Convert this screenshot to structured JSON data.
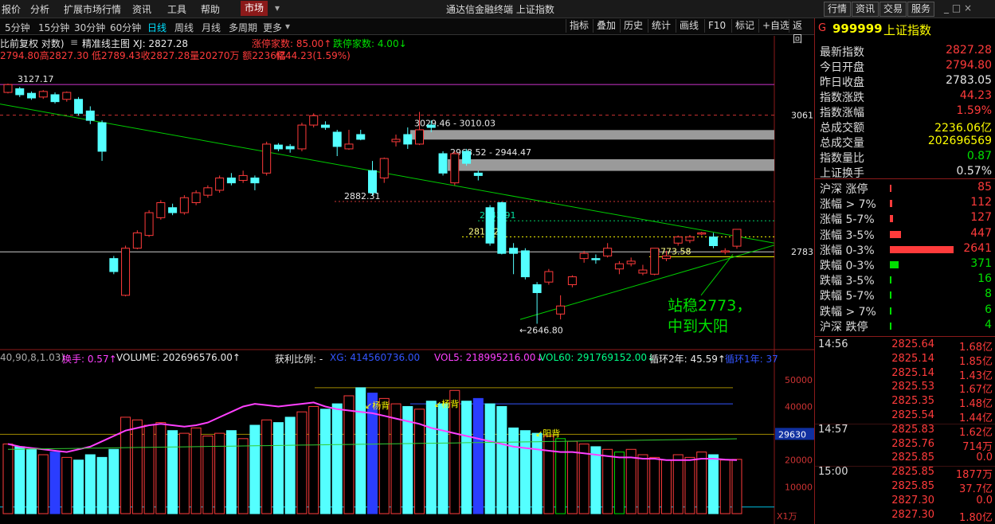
{
  "window": {
    "title": "通达信金融终端 上证指数",
    "menu": [
      "报价",
      "分析",
      "扩展市场行情",
      "资讯",
      "工具",
      "帮助"
    ],
    "market_tab": "市场",
    "right_tabs": [
      "行情",
      "资讯",
      "交易",
      "服务"
    ],
    "controls": "_ □ ×"
  },
  "toolbar": {
    "periods": [
      "5分钟",
      "15分钟",
      "30分钟",
      "60分钟",
      "日线",
      "周线",
      "月线",
      "多周期",
      "更多"
    ],
    "active_period": "日线",
    "tools": [
      "指标",
      "叠加",
      "历史",
      "统计",
      "画线",
      "F10",
      "标记",
      "+自选",
      "返回"
    ]
  },
  "info": {
    "line1_left": "比前复权 对数)",
    "line1_icon": "≡",
    "line1_main": "精准线主图 XJ: 2827.28",
    "limit_up": "涨停家数: 85.00↑",
    "limit_down": "跌停家数: 4.00↓",
    "line2": "2794.80高2827.30 低2789.43收2827.28量20270万 额2236亿",
    "line2_change": "幅44.23(1.59%)"
  },
  "chart_data": {
    "type": "candlestick",
    "y_scale": "log",
    "ylim": [
      2620,
      3150
    ],
    "y_ticks": [
      "3061",
      "2783"
    ],
    "candles": [
      {
        "o": 3110,
        "c": 3127,
        "h": 3129,
        "l": 3108
      },
      {
        "o": 3118,
        "c": 3105,
        "h": 3122,
        "l": 3100
      },
      {
        "o": 3108,
        "c": 3098,
        "h": 3112,
        "l": 3094
      },
      {
        "o": 3100,
        "c": 3112,
        "h": 3115,
        "l": 3096
      },
      {
        "o": 3105,
        "c": 3090,
        "h": 3110,
        "l": 3086
      },
      {
        "o": 3095,
        "c": 3110,
        "h": 3112,
        "l": 3090
      },
      {
        "o": 3095,
        "c": 3065,
        "h": 3100,
        "l": 3060
      },
      {
        "o": 3070,
        "c": 3050,
        "h": 3080,
        "l": 3042
      },
      {
        "o": 3045,
        "c": 2985,
        "h": 3050,
        "l": 2965
      },
      {
        "o": 2770,
        "c": 2745,
        "h": 2775,
        "l": 2740
      },
      {
        "o": 2700,
        "c": 2790,
        "h": 2795,
        "l": 2698
      },
      {
        "o": 2790,
        "c": 2820,
        "h": 2825,
        "l": 2788
      },
      {
        "o": 2815,
        "c": 2860,
        "h": 2865,
        "l": 2812
      },
      {
        "o": 2850,
        "c": 2880,
        "h": 2885,
        "l": 2846
      },
      {
        "o": 2870,
        "c": 2860,
        "h": 2878,
        "l": 2855
      },
      {
        "o": 2860,
        "c": 2890,
        "h": 2895,
        "l": 2856
      },
      {
        "o": 2880,
        "c": 2900,
        "h": 2905,
        "l": 2875
      },
      {
        "o": 2895,
        "c": 2910,
        "h": 2915,
        "l": 2890
      },
      {
        "o": 2905,
        "c": 2930,
        "h": 2935,
        "l": 2900
      },
      {
        "o": 2930,
        "c": 2920,
        "h": 2940,
        "l": 2915
      },
      {
        "o": 2925,
        "c": 2935,
        "h": 2945,
        "l": 2920
      },
      {
        "o": 2930,
        "c": 2920,
        "h": 2935,
        "l": 2905
      },
      {
        "o": 2940,
        "c": 3000,
        "h": 3005,
        "l": 2935
      },
      {
        "o": 2998,
        "c": 2990,
        "h": 3002,
        "l": 2985
      },
      {
        "o": 2995,
        "c": 2990,
        "h": 3000,
        "l": 2982
      },
      {
        "o": 2990,
        "c": 3040,
        "h": 3045,
        "l": 2985
      },
      {
        "o": 3040,
        "c": 3060,
        "h": 3065,
        "l": 3035
      },
      {
        "o": 3040,
        "c": 3035,
        "h": 3048,
        "l": 3030
      },
      {
        "o": 3025,
        "c": 2995,
        "h": 3030,
        "l": 2975
      },
      {
        "o": 2990,
        "c": 3000,
        "h": 3030,
        "l": 2988
      },
      {
        "o": 3020,
        "c": 3010,
        "h": 3030,
        "l": 3008
      },
      {
        "o": 2945,
        "c": 2900,
        "h": 2965,
        "l": 2895
      },
      {
        "o": 2930,
        "c": 2970,
        "h": 2972,
        "l": 2920
      },
      {
        "o": 3005,
        "c": 3010,
        "h": 3020,
        "l": 2995
      },
      {
        "o": 3020,
        "c": 3000,
        "h": 3035,
        "l": 2990
      },
      {
        "o": 3000,
        "c": 3030,
        "h": 3068,
        "l": 2998
      },
      {
        "o": 3040,
        "c": 3035,
        "h": 3050,
        "l": 3025
      },
      {
        "o": 2980,
        "c": 2940,
        "h": 2985,
        "l": 2935
      },
      {
        "o": 2920,
        "c": 2980,
        "h": 2985,
        "l": 2915
      },
      {
        "o": 2985,
        "c": 2960,
        "h": 2990,
        "l": 2955
      },
      {
        "o": 2940,
        "c": 2935,
        "h": 2945,
        "l": 2925
      },
      {
        "o": 2870,
        "c": 2800,
        "h": 2875,
        "l": 2795
      },
      {
        "o": 2880,
        "c": 2780,
        "h": 2882,
        "l": 2778
      },
      {
        "o": 2790,
        "c": 2780,
        "h": 2800,
        "l": 2740
      },
      {
        "o": 2785,
        "c": 2735,
        "h": 2790,
        "l": 2730
      },
      {
        "o": 2720,
        "c": 2705,
        "h": 2725,
        "l": 2647
      },
      {
        "o": 2725,
        "c": 2745,
        "h": 2750,
        "l": 2720
      },
      {
        "o": 2665,
        "c": 2680,
        "h": 2700,
        "l": 2655
      },
      {
        "o": 2720,
        "c": 2735,
        "h": 2738,
        "l": 2715
      },
      {
        "o": 2770,
        "c": 2780,
        "h": 2785,
        "l": 2762
      },
      {
        "o": 2770,
        "c": 2768,
        "h": 2778,
        "l": 2760
      },
      {
        "o": 2775,
        "c": 2790,
        "h": 2800,
        "l": 2772
      },
      {
        "o": 2750,
        "c": 2760,
        "h": 2765,
        "l": 2740
      },
      {
        "o": 2760,
        "c": 2765,
        "h": 2772,
        "l": 2755
      },
      {
        "o": 2742,
        "c": 2748,
        "h": 2758,
        "l": 2738
      },
      {
        "o": 2740,
        "c": 2790,
        "h": 2790,
        "l": 2738
      },
      {
        "o": 2770,
        "c": 2775,
        "h": 2785,
        "l": 2765
      },
      {
        "o": 2800,
        "c": 2812,
        "h": 2815,
        "l": 2795
      },
      {
        "o": 2805,
        "c": 2812,
        "h": 2816,
        "l": 2800
      },
      {
        "o": 2818,
        "c": 2820,
        "h": 2822,
        "l": 2815
      },
      {
        "o": 2812,
        "c": 2795,
        "h": 2820,
        "l": 2790
      },
      {
        "o": 2785,
        "c": 2785,
        "h": 2790,
        "l": 2778
      },
      {
        "o": 2794,
        "c": 2827,
        "h": 2827,
        "l": 2789
      }
    ],
    "zones": [
      {
        "label": "3029.46 - 3010.03",
        "top": 3029.46,
        "bottom": 3010.03
      },
      {
        "label": "2968.52 - 2944.47",
        "top": 2968.52,
        "bottom": 2944.47
      }
    ],
    "levels": [
      {
        "value": 3127.17,
        "label": "3127.17",
        "color": "#cc33cc"
      },
      {
        "value": 3061,
        "label": "",
        "color": "#cc3333"
      },
      {
        "value": 2882.31,
        "label": "2882.31",
        "color": "#cc3333"
      },
      {
        "value": 2843.91,
        "label": "2843.91",
        "color": "#00cc66"
      },
      {
        "value": 2812.23,
        "label": "2812.23",
        "color": "#ffff00"
      },
      {
        "value": 2783,
        "label": "",
        "color": "#cccccc"
      },
      {
        "value": 2773.58,
        "label": "2773.58",
        "color": "#ffff00"
      }
    ],
    "low_label": "2646.80",
    "annotation": [
      "站稳2773，",
      "中到大阳"
    ]
  },
  "vol_info": {
    "params": "40,90,8,1.03)",
    "turnover": "换手: 0.57↑",
    "volume": "VOLUME: 202696576.00↑",
    "profit": "获利比例: -",
    "xg": "XG: 414560736.00",
    "vol5": "VOL5: 218995216.00↓",
    "vol60": "VOL60: 291769152.00↓",
    "cycle2": "循环2年: 45.59↑",
    "cycle1": "循环1年: 37",
    "labels": [
      "杨背",
      "杨背",
      "阳背"
    ],
    "y_ticks": [
      "50000",
      "40000",
      "30000",
      "20000",
      "10000"
    ],
    "current_marker": "29630",
    "unit": "X1万",
    "volumes": [
      26000,
      25000,
      24000,
      22000,
      23000,
      21000,
      20000,
      22000,
      21000,
      24000,
      36000,
      35000,
      33000,
      34000,
      31000,
      30000,
      32000,
      29000,
      30000,
      31000,
      28000,
      33000,
      35000,
      34000,
      36000,
      38000,
      40000,
      39000,
      41000,
      44000,
      47000,
      45000,
      43000,
      41000,
      40000,
      39000,
      42000,
      41000,
      46000,
      42000,
      43000,
      41000,
      40000,
      32000,
      31000,
      30000,
      29000,
      28000,
      27000,
      26000,
      25000,
      24000,
      23000,
      24000,
      22000,
      21000,
      20000,
      22000,
      21000,
      23000,
      22000,
      20000,
      20270
    ],
    "ma_line": [
      26000,
      25000,
      24500,
      24000,
      23500,
      23000,
      24000,
      25000,
      27000,
      29000,
      31000,
      32000,
      33000,
      33500,
      33000,
      32500,
      33000,
      34000,
      36000,
      38000,
      40000,
      41000,
      40500,
      40000,
      40500,
      41000,
      41500,
      40000,
      39000,
      38500,
      38000,
      37500,
      36500,
      35500,
      34500,
      33500,
      32000,
      31000,
      30000,
      29000,
      28000,
      27000,
      26000,
      25000,
      24500,
      24000,
      23500,
      23000,
      23000,
      22500,
      22000,
      21500,
      21000,
      21000,
      20500,
      20500,
      20000,
      20000,
      20000,
      20500,
      20500,
      20200,
      20000
    ]
  },
  "right_panel": {
    "code_icon": "G",
    "code": "999999",
    "name": "上证指数",
    "rows": [
      {
        "label": "最新指数",
        "value": "2827.28",
        "color": "#ff3b3b"
      },
      {
        "label": "今日开盘",
        "value": "2794.80",
        "color": "#ff3b3b"
      },
      {
        "label": "昨日收盘",
        "value": "2783.05",
        "color": "#e8e8e8"
      },
      {
        "label": "指数涨跌",
        "value": "44.23",
        "color": "#ff3b3b"
      },
      {
        "label": "指数涨幅",
        "value": "1.59%",
        "color": "#ff3b3b"
      },
      {
        "label": "总成交额",
        "value": "2236.06亿",
        "color": "#ffff00"
      },
      {
        "label": "总成交量",
        "value": "202696569",
        "color": "#ffff00"
      },
      {
        "label": "指数量比",
        "value": "0.87",
        "color": "#00e000"
      },
      {
        "label": "上证换手",
        "value": "0.57%",
        "color": "#e8e8e8"
      }
    ],
    "breadth": [
      {
        "label": "沪深 涨停",
        "value": "85",
        "color": "#ff3b3b",
        "frac": 0.03
      },
      {
        "label": "涨幅 > 7%",
        "value": "112",
        "color": "#ff3b3b",
        "frac": 0.04
      },
      {
        "label": "涨幅 5-7%",
        "value": "127",
        "color": "#ff3b3b",
        "frac": 0.05
      },
      {
        "label": "涨幅 3-5%",
        "value": "447",
        "color": "#ff3b3b",
        "frac": 0.17
      },
      {
        "label": "涨幅 0-3%",
        "value": "2641",
        "color": "#ff3b3b",
        "frac": 1.0
      },
      {
        "label": "跌幅 0-3%",
        "value": "371",
        "color": "#00e000",
        "frac": 0.14
      },
      {
        "label": "跌幅 3-5%",
        "value": "16",
        "color": "#00e000",
        "frac": 0.01
      },
      {
        "label": "跌幅 5-7%",
        "value": "8",
        "color": "#00e000",
        "frac": 0.005
      },
      {
        "label": "跌幅 > 7%",
        "value": "6",
        "color": "#00e000",
        "frac": 0.005
      },
      {
        "label": "沪深 跌停",
        "value": "4",
        "color": "#00e000",
        "frac": 0.0
      }
    ],
    "ticks": [
      {
        "time": "14:56",
        "price": "2825.64",
        "vol": "1.68亿"
      },
      {
        "time": "",
        "price": "2825.14",
        "vol": "1.85亿"
      },
      {
        "time": "",
        "price": "2825.14",
        "vol": "1.43亿"
      },
      {
        "time": "",
        "price": "2825.53",
        "vol": "1.67亿"
      },
      {
        "time": "",
        "price": "2825.35",
        "vol": "1.48亿"
      },
      {
        "time": "",
        "price": "2825.54",
        "vol": "1.44亿"
      },
      {
        "time": "14:57",
        "price": "2825.83",
        "vol": "1.62亿"
      },
      {
        "time": "",
        "price": "2825.76",
        "vol": "714万"
      },
      {
        "time": "",
        "price": "2825.85",
        "vol": "0.0"
      },
      {
        "time": "15:00",
        "price": "2825.85",
        "vol": "1877万"
      },
      {
        "time": "",
        "price": "2825.85",
        "vol": "37.7亿"
      },
      {
        "time": "",
        "price": "2827.30",
        "vol": "0.0"
      },
      {
        "time": "",
        "price": "2827.30",
        "vol": "1.80亿"
      }
    ]
  }
}
